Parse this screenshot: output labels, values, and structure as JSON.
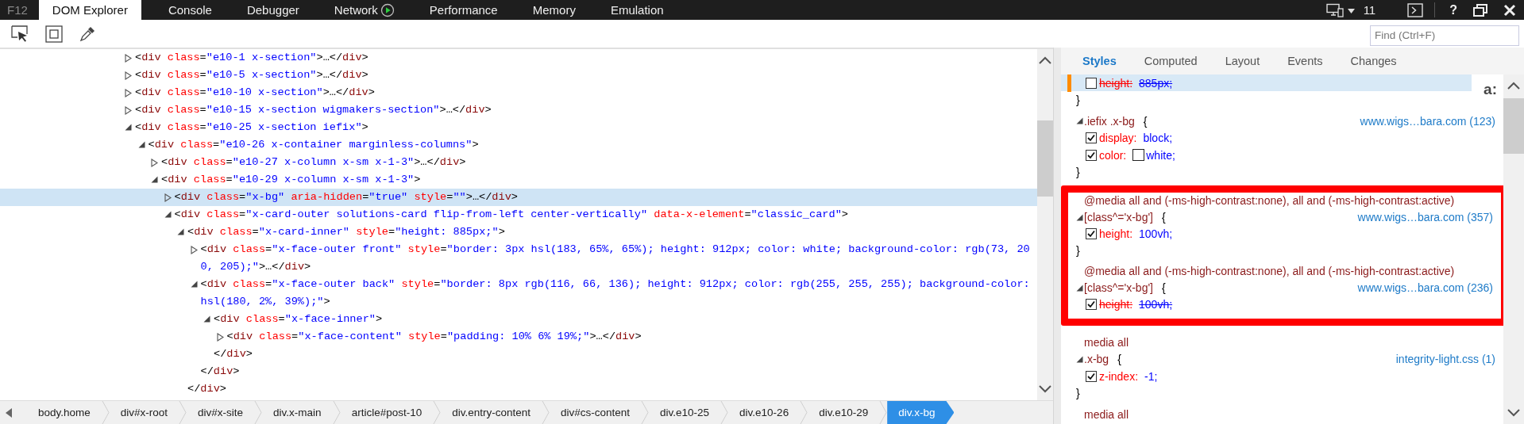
{
  "app_label": "F12",
  "tabs": [
    {
      "label": "DOM Explorer",
      "selected": true,
      "kind": "plain"
    },
    {
      "label": "Console",
      "selected": false,
      "kind": "plain"
    },
    {
      "label": "Debugger",
      "selected": false,
      "kind": "plain"
    },
    {
      "label": "Network",
      "selected": false,
      "kind": "recording"
    },
    {
      "label": "Performance",
      "selected": false,
      "kind": "plain"
    },
    {
      "label": "Memory",
      "selected": false,
      "kind": "plain"
    },
    {
      "label": "Emulation",
      "selected": false,
      "kind": "plain"
    }
  ],
  "document_mode": {
    "label": "11"
  },
  "help": {
    "label": "?"
  },
  "find": {
    "placeholder": "Find (Ctrl+F)"
  },
  "dom_tree": [
    {
      "selected": false,
      "expanded": false,
      "tokens": [
        {
          "kind": "punct",
          "text": "<"
        },
        {
          "kind": "tag",
          "text": "div"
        },
        {
          "kind": "attr",
          "text": " class"
        },
        {
          "kind": "punct",
          "text": "="
        },
        {
          "kind": "value",
          "text": "\"e10-1 x-section\""
        },
        {
          "kind": "punct",
          "text": ">…</"
        },
        {
          "kind": "tag",
          "text": "div"
        },
        {
          "kind": "punct",
          "text": ">"
        }
      ]
    },
    {
      "selected": false,
      "expanded": false,
      "tokens": [
        {
          "kind": "punct",
          "text": "<"
        },
        {
          "kind": "tag",
          "text": "div"
        },
        {
          "kind": "attr",
          "text": " class"
        },
        {
          "kind": "punct",
          "text": "="
        },
        {
          "kind": "value",
          "text": "\"e10-5 x-section\""
        },
        {
          "kind": "punct",
          "text": ">…</"
        },
        {
          "kind": "tag",
          "text": "div"
        },
        {
          "kind": "punct",
          "text": ">"
        }
      ]
    },
    {
      "selected": false,
      "expanded": false,
      "tokens": [
        {
          "kind": "punct",
          "text": "<"
        },
        {
          "kind": "tag",
          "text": "div"
        },
        {
          "kind": "attr",
          "text": " class"
        },
        {
          "kind": "punct",
          "text": "="
        },
        {
          "kind": "value",
          "text": "\"e10-10 x-section\""
        },
        {
          "kind": "punct",
          "text": ">…</"
        },
        {
          "kind": "tag",
          "text": "div"
        },
        {
          "kind": "punct",
          "text": ">"
        }
      ]
    },
    {
      "selected": false,
      "expanded": false,
      "tokens": [
        {
          "kind": "punct",
          "text": "<"
        },
        {
          "kind": "tag",
          "text": "div"
        },
        {
          "kind": "attr",
          "text": " class"
        },
        {
          "kind": "punct",
          "text": "="
        },
        {
          "kind": "value",
          "text": "\"e10-15 x-section wigmakers-section\""
        },
        {
          "kind": "punct",
          "text": ">…</"
        },
        {
          "kind": "tag",
          "text": "div"
        },
        {
          "kind": "punct",
          "text": ">"
        }
      ]
    },
    {
      "selected": false,
      "expanded": true,
      "tokens": [
        {
          "kind": "punct",
          "text": "<"
        },
        {
          "kind": "tag",
          "text": "div"
        },
        {
          "kind": "attr",
          "text": " class"
        },
        {
          "kind": "punct",
          "text": "="
        },
        {
          "kind": "value",
          "text": "\"e10-25 x-section iefix\""
        },
        {
          "kind": "punct",
          "text": ">"
        }
      ],
      "children": [
        {
          "selected": false,
          "expanded": true,
          "tokens": [
            {
              "kind": "punct",
              "text": "<"
            },
            {
              "kind": "tag",
              "text": "div"
            },
            {
              "kind": "attr",
              "text": " class"
            },
            {
              "kind": "punct",
              "text": "="
            },
            {
              "kind": "value",
              "text": "\"e10-26 x-container marginless-columns\""
            },
            {
              "kind": "punct",
              "text": ">"
            }
          ],
          "children": [
            {
              "selected": false,
              "expanded": false,
              "tokens": [
                {
                  "kind": "punct",
                  "text": "<"
                },
                {
                  "kind": "tag",
                  "text": "div"
                },
                {
                  "kind": "attr",
                  "text": " class"
                },
                {
                  "kind": "punct",
                  "text": "="
                },
                {
                  "kind": "value",
                  "text": "\"e10-27 x-column x-sm x-1-3\""
                },
                {
                  "kind": "punct",
                  "text": ">…</"
                },
                {
                  "kind": "tag",
                  "text": "div"
                },
                {
                  "kind": "punct",
                  "text": ">"
                }
              ]
            },
            {
              "selected": false,
              "expanded": true,
              "tokens": [
                {
                  "kind": "punct",
                  "text": "<"
                },
                {
                  "kind": "tag",
                  "text": "div"
                },
                {
                  "kind": "attr",
                  "text": " class"
                },
                {
                  "kind": "punct",
                  "text": "="
                },
                {
                  "kind": "value",
                  "text": "\"e10-29 x-column x-sm x-1-3\""
                },
                {
                  "kind": "punct",
                  "text": ">"
                }
              ],
              "children": [
                {
                  "selected": true,
                  "expanded": false,
                  "tokens": [
                    {
                      "kind": "punct",
                      "text": "<"
                    },
                    {
                      "kind": "tag",
                      "text": "div"
                    },
                    {
                      "kind": "attr",
                      "text": " class"
                    },
                    {
                      "kind": "punct",
                      "text": "="
                    },
                    {
                      "kind": "value",
                      "text": "\"x-bg\""
                    },
                    {
                      "kind": "attr",
                      "text": " aria-hidden"
                    },
                    {
                      "kind": "punct",
                      "text": "="
                    },
                    {
                      "kind": "value",
                      "text": "\"true\""
                    },
                    {
                      "kind": "attr",
                      "text": " style"
                    },
                    {
                      "kind": "punct",
                      "text": "="
                    },
                    {
                      "kind": "value",
                      "text": "\"\""
                    },
                    {
                      "kind": "punct",
                      "text": ">…</"
                    },
                    {
                      "kind": "tag",
                      "text": "div"
                    },
                    {
                      "kind": "punct",
                      "text": ">"
                    }
                  ]
                },
                {
                  "selected": false,
                  "expanded": true,
                  "tokens": [
                    {
                      "kind": "punct",
                      "text": "<"
                    },
                    {
                      "kind": "tag",
                      "text": "div"
                    },
                    {
                      "kind": "attr",
                      "text": " class"
                    },
                    {
                      "kind": "punct",
                      "text": "="
                    },
                    {
                      "kind": "value",
                      "text": "\"x-card-outer solutions-card flip-from-left center-vertically\""
                    },
                    {
                      "kind": "attr",
                      "text": " data-x-element"
                    },
                    {
                      "kind": "punct",
                      "text": "="
                    },
                    {
                      "kind": "value",
                      "text": "\"classic_card\""
                    },
                    {
                      "kind": "punct",
                      "text": ">"
                    }
                  ],
                  "children": [
                    {
                      "selected": false,
                      "expanded": true,
                      "tokens": [
                        {
                          "kind": "punct",
                          "text": "<"
                        },
                        {
                          "kind": "tag",
                          "text": "div"
                        },
                        {
                          "kind": "attr",
                          "text": " class"
                        },
                        {
                          "kind": "punct",
                          "text": "="
                        },
                        {
                          "kind": "value",
                          "text": "\"x-card-inner\""
                        },
                        {
                          "kind": "attr",
                          "text": " style"
                        },
                        {
                          "kind": "punct",
                          "text": "="
                        },
                        {
                          "kind": "value",
                          "text": "\"height: 885px;\""
                        },
                        {
                          "kind": "punct",
                          "text": ">"
                        }
                      ],
                      "children": [
                        {
                          "selected": false,
                          "expanded": false,
                          "tokens": [
                            {
                              "kind": "punct",
                              "text": "<"
                            },
                            {
                              "kind": "tag",
                              "text": "div"
                            },
                            {
                              "kind": "attr",
                              "text": " class"
                            },
                            {
                              "kind": "punct",
                              "text": "="
                            },
                            {
                              "kind": "value",
                              "text": "\"x-face-outer front\""
                            },
                            {
                              "kind": "attr",
                              "text": " style"
                            },
                            {
                              "kind": "punct",
                              "text": "="
                            },
                            {
                              "kind": "value",
                              "text": "\"border: 3px hsl(183, 65%, 65%); height: 912px; color: white; background-color: rgb(73, 200, 205);\""
                            },
                            {
                              "kind": "punct",
                              "text": ">…</"
                            },
                            {
                              "kind": "tag",
                              "text": "div"
                            },
                            {
                              "kind": "punct",
                              "text": ">"
                            }
                          ]
                        },
                        {
                          "selected": false,
                          "expanded": true,
                          "tokens": [
                            {
                              "kind": "punct",
                              "text": "<"
                            },
                            {
                              "kind": "tag",
                              "text": "div"
                            },
                            {
                              "kind": "attr",
                              "text": " class"
                            },
                            {
                              "kind": "punct",
                              "text": "="
                            },
                            {
                              "kind": "value",
                              "text": "\"x-face-outer back\""
                            },
                            {
                              "kind": "attr",
                              "text": " style"
                            },
                            {
                              "kind": "punct",
                              "text": "="
                            },
                            {
                              "kind": "value",
                              "text": "\"border: 8px rgb(116, 66, 136); height: 912px; color: rgb(255, 255, 255); background-color: hsl(180, 2%, 39%);\""
                            },
                            {
                              "kind": "punct",
                              "text": ">"
                            }
                          ],
                          "children": [
                            {
                              "selected": false,
                              "expanded": true,
                              "tokens": [
                                {
                                  "kind": "punct",
                                  "text": "<"
                                },
                                {
                                  "kind": "tag",
                                  "text": "div"
                                },
                                {
                                  "kind": "attr",
                                  "text": " class"
                                },
                                {
                                  "kind": "punct",
                                  "text": "="
                                },
                                {
                                  "kind": "value",
                                  "text": "\"x-face-inner\""
                                },
                                {
                                  "kind": "punct",
                                  "text": ">"
                                }
                              ],
                              "children": [
                                {
                                  "selected": false,
                                  "expanded": false,
                                  "tokens": [
                                    {
                                      "kind": "punct",
                                      "text": "<"
                                    },
                                    {
                                      "kind": "tag",
                                      "text": "div"
                                    },
                                    {
                                      "kind": "attr",
                                      "text": " class"
                                    },
                                    {
                                      "kind": "punct",
                                      "text": "="
                                    },
                                    {
                                      "kind": "value",
                                      "text": "\"x-face-content\""
                                    },
                                    {
                                      "kind": "attr",
                                      "text": " style"
                                    },
                                    {
                                      "kind": "punct",
                                      "text": "="
                                    },
                                    {
                                      "kind": "value",
                                      "text": "\"padding: 10% 6% 19%;\""
                                    },
                                    {
                                      "kind": "punct",
                                      "text": ">…</"
                                    },
                                    {
                                      "kind": "tag",
                                      "text": "div"
                                    },
                                    {
                                      "kind": "punct",
                                      "text": ">"
                                    }
                                  ]
                                }
                              ],
                              "closing": [
                                {
                                  "kind": "punct",
                                  "text": "</"
                                },
                                {
                                  "kind": "tag",
                                  "text": "div"
                                },
                                {
                                  "kind": "punct",
                                  "text": ">"
                                }
                              ]
                            }
                          ],
                          "closing": [
                            {
                              "kind": "punct",
                              "text": "</"
                            },
                            {
                              "kind": "tag",
                              "text": "div"
                            },
                            {
                              "kind": "punct",
                              "text": ">"
                            }
                          ]
                        }
                      ],
                      "closing": [
                        {
                          "kind": "punct",
                          "text": "</"
                        },
                        {
                          "kind": "tag",
                          "text": "div"
                        },
                        {
                          "kind": "punct",
                          "text": ">"
                        }
                      ]
                    }
                  ]
                }
              ]
            }
          ]
        }
      ]
    }
  ],
  "styles": {
    "tabs": [
      {
        "label": "Styles",
        "selected": true
      },
      {
        "label": "Computed",
        "selected": false
      },
      {
        "label": "Layout",
        "selected": false
      },
      {
        "label": "Events",
        "selected": false
      },
      {
        "label": "Changes",
        "selected": false
      }
    ],
    "pseudo_button": {
      "label": "a:"
    },
    "rules": [
      {
        "highlighted": false,
        "declarations": [
          {
            "kind": "plain",
            "property": "height:",
            "value": "885px;",
            "enabled": false,
            "overridden": true,
            "selected": true,
            "modified": true
          }
        ],
        "closing": "}"
      },
      {
        "highlighted": false,
        "selector": ".iefix .x-bg",
        "brace": "{",
        "expanded": true,
        "source": "www.wigs…bara.com (123)",
        "declarations": [
          {
            "kind": "plain",
            "property": "display:",
            "value": "block;",
            "enabled": true,
            "overridden": false,
            "selected": false,
            "modified": false
          },
          {
            "kind": "color",
            "property": "color:",
            "value": "white;",
            "enabled": true,
            "overridden": false,
            "selected": false,
            "modified": false
          }
        ],
        "closing": "}"
      },
      {
        "highlighted": true,
        "media": "@media all and (-ms-high-contrast:none), all and (-ms-high-contrast:active)",
        "selector": "[class^='x-bg']",
        "brace": "{",
        "expanded": true,
        "source": "www.wigs…bara.com (357)",
        "declarations": [
          {
            "kind": "plain",
            "property": "height:",
            "value": "100vh;",
            "enabled": true,
            "overridden": false,
            "selected": false,
            "modified": false
          }
        ],
        "closing": "}"
      },
      {
        "highlighted": true,
        "media": "@media all and (-ms-high-contrast:none), all and (-ms-high-contrast:active)",
        "selector": "[class^='x-bg']",
        "brace": "{",
        "expanded": true,
        "source": "www.wigs…bara.com (236)",
        "declarations": [
          {
            "kind": "plain",
            "property": "height:",
            "value": "100vh;",
            "enabled": true,
            "overridden": true,
            "selected": false,
            "modified": false
          }
        ]
      },
      {
        "highlighted": false,
        "media": "media all",
        "selector": ".x-bg",
        "brace": "{",
        "expanded": true,
        "source": "integrity-light.css (1)",
        "declarations": [
          {
            "kind": "plain",
            "property": "z-index:",
            "value": "-1;",
            "enabled": true,
            "overridden": false,
            "selected": false,
            "modified": false
          }
        ],
        "closing": "}"
      },
      {
        "highlighted": false,
        "media": "media all"
      }
    ]
  },
  "breadcrumb": [
    {
      "label": "body.home",
      "selected": false
    },
    {
      "label": "div#x-root",
      "selected": false
    },
    {
      "label": "div#x-site",
      "selected": false
    },
    {
      "label": "div.x-main",
      "selected": false
    },
    {
      "label": "article#post-10",
      "selected": false
    },
    {
      "label": "div.entry-content",
      "selected": false
    },
    {
      "label": "div#cs-content",
      "selected": false
    },
    {
      "label": "div.e10-25",
      "selected": false
    },
    {
      "label": "div.e10-26",
      "selected": false
    },
    {
      "label": "div.e10-29",
      "selected": false
    },
    {
      "label": "div.x-bg",
      "selected": true
    }
  ]
}
